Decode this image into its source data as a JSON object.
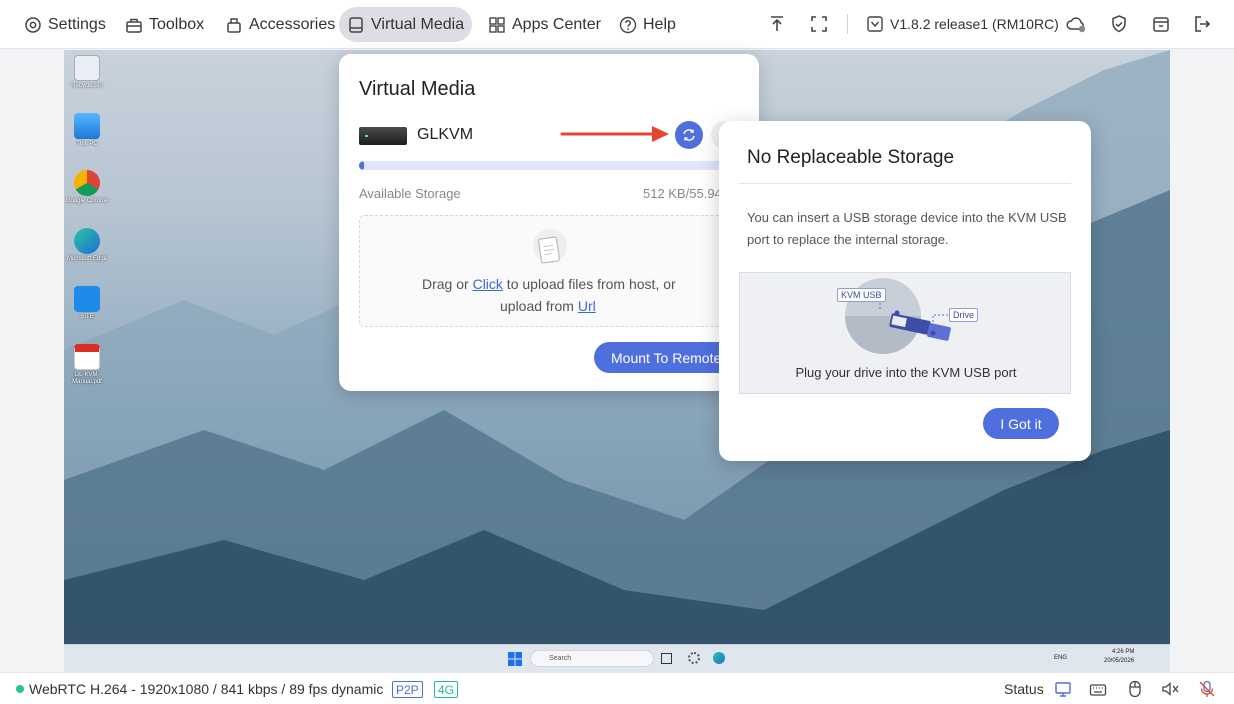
{
  "nav": {
    "items": [
      {
        "label": "Settings",
        "icon": "gear-icon"
      },
      {
        "label": "Toolbox",
        "icon": "toolbox-icon"
      },
      {
        "label": "Accessories",
        "icon": "accessories-icon"
      },
      {
        "label": "Virtual Media",
        "icon": "drive-icon",
        "active": true
      },
      {
        "label": "Apps Center",
        "icon": "apps-icon"
      },
      {
        "label": "Help",
        "icon": "help-icon"
      }
    ]
  },
  "toolbar": {
    "version": "V1.8.2 release1 (RM10RC)",
    "icons": [
      "upload-icon",
      "fullscreen-icon",
      "version-icon",
      "cloud-status-icon",
      "shield-icon",
      "window-switch-icon",
      "logout-icon"
    ]
  },
  "desktop": {
    "icons": [
      {
        "label": "Recycle Bin",
        "icon": "recycle-bin-icon"
      },
      {
        "label": "This PC",
        "icon": "this-pc-icon"
      },
      {
        "label": "Google Chrome",
        "icon": "chrome-icon"
      },
      {
        "label": "Microsoft Edge",
        "icon": "edge-icon"
      },
      {
        "label": "SITE",
        "icon": "app-shortcut-icon"
      },
      {
        "label": "GL-KVM-Manual.pdf",
        "icon": "pdf-icon"
      }
    ],
    "taskbar": {
      "search_placeholder": "Search",
      "tray_lang": "ENG",
      "time": "4:26 PM",
      "date": "20/05/2026"
    }
  },
  "virtual_media": {
    "title": "Virtual Media",
    "device_name": "GLKVM",
    "storage_label": "Available Storage",
    "storage_value": "512 KB/55.94",
    "storage_used_fraction": 0.01,
    "dropzone": {
      "prefix": "Drag or ",
      "click_link": "Click",
      "middle": " to upload files from host, or",
      "line2_prefix": "upload from ",
      "url_link": "Url"
    },
    "mount_button": "Mount To Remote"
  },
  "popup": {
    "title": "No Replaceable Storage",
    "body": "You can insert a USB storage device into the KVM USB port to replace the internal storage.",
    "illustration": {
      "kvm_tag": "KVM USB",
      "drive_tag": "Drive",
      "caption": "Plug your drive into the KVM USB port"
    },
    "button": "I Got it"
  },
  "status_bar": {
    "connection_text": "WebRTC H.264 - 1920x1080 /  841 kbps / 89 fps dynamic",
    "badge_p2p": "P2P",
    "badge_network": "4G",
    "status_label": "Status",
    "accent_green": "#22c29a",
    "icons": [
      "monitor-icon",
      "keyboard-icon",
      "mouse-icon",
      "speaker-muted-icon",
      "microphone-muted-icon"
    ]
  },
  "colors": {
    "accent": "#4f6fde",
    "annotation_red": "#e5452d"
  }
}
